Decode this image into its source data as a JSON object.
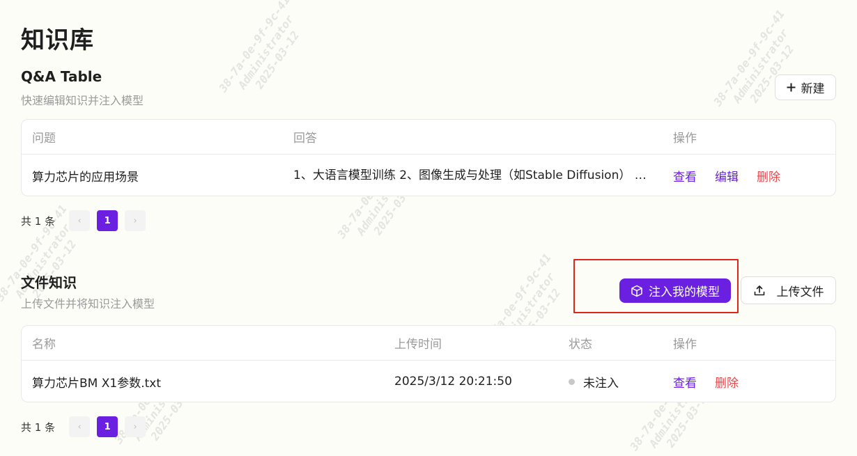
{
  "page": {
    "title": "知识库"
  },
  "qa": {
    "title": "Q&A Table",
    "desc": "快速编辑知识并注入模型",
    "new_label": "新建",
    "headers": {
      "question": "问题",
      "answer": "回答",
      "actions": "操作"
    },
    "rows": [
      {
        "question": "算力芯片的应用场景",
        "answer": "1、大语言模型训练 2、图像生成与处理（如Stable Diffusion） 3…",
        "view": "查看",
        "edit": "编辑",
        "delete": "删除"
      }
    ],
    "pagination": {
      "total": "共 1 条",
      "page": "1",
      "prev": "‹",
      "next": "›"
    }
  },
  "files": {
    "title": "文件知识",
    "desc": "上传文件并将知识注入模型",
    "inject_label": "注入我的模型",
    "upload_label": "上传文件",
    "headers": {
      "name": "名称",
      "time": "上传时间",
      "status": "状态",
      "actions": "操作"
    },
    "rows": [
      {
        "name": "算力芯片BM X1参数.txt",
        "time": "2025/3/12 20:21:50",
        "status": "未注入",
        "view": "查看",
        "delete": "删除"
      }
    ],
    "pagination": {
      "total": "共 1 条",
      "page": "1",
      "prev": "‹",
      "next": "›"
    }
  },
  "watermark": {
    "line1": "38-7a-0e-9f-9c-41",
    "line2": "Administrator",
    "line3": "2025-03-12"
  },
  "colors": {
    "accent": "#6b1fe0",
    "danger": "#e5484d",
    "highlight": "#e0251b"
  },
  "icons": {
    "new": "plus-icon",
    "inject": "cube-icon",
    "upload": "upload-icon",
    "status": "status-dot"
  }
}
